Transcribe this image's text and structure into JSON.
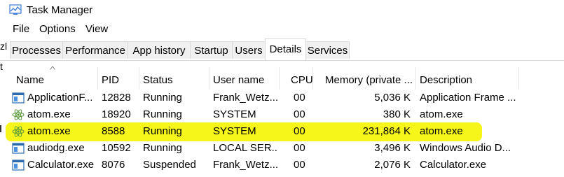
{
  "window": {
    "title": "Task Manager"
  },
  "menu": [
    "File",
    "Options",
    "View"
  ],
  "side_marks": [
    "zl",
    "t"
  ],
  "tabs": [
    {
      "label": "Processes",
      "active": false
    },
    {
      "label": "Performance",
      "active": false
    },
    {
      "label": "App history",
      "active": false
    },
    {
      "label": "Startup",
      "active": false
    },
    {
      "label": "Users",
      "active": false
    },
    {
      "label": "Details",
      "active": true
    },
    {
      "label": "Services",
      "active": false
    }
  ],
  "columns": {
    "name": "Name",
    "pid": "PID",
    "status": "Status",
    "user": "User name",
    "cpu": "CPU",
    "memory": "Memory (private ...",
    "description": "Description"
  },
  "rows": [
    {
      "icon": "app-frame-icon",
      "name": "ApplicationF...",
      "pid": "12828",
      "status": "Running",
      "user": "Frank_Wetz...",
      "cpu": "00",
      "memory": "5,036 K",
      "description": "Application Frame ..."
    },
    {
      "icon": "atom-icon",
      "name": "atom.exe",
      "pid": "18920",
      "status": "Running",
      "user": "SYSTEM",
      "cpu": "00",
      "memory": "380 K",
      "description": "atom.exe"
    },
    {
      "icon": "atom-icon",
      "name": "atom.exe",
      "pid": "8588",
      "status": "Running",
      "user": "SYSTEM",
      "cpu": "00",
      "memory": "231,864 K",
      "description": "atom.exe",
      "highlighted": true
    },
    {
      "icon": "app-frame-icon",
      "name": "audiodg.exe",
      "pid": "10592",
      "status": "Running",
      "user": "LOCAL SER...",
      "cpu": "00",
      "memory": "3,496 K",
      "description": "Windows Audio D..."
    },
    {
      "icon": "app-frame-icon",
      "name": "Calculator.exe",
      "pid": "8076",
      "status": "Suspended",
      "user": "Frank_Wetz...",
      "cpu": "00",
      "memory": "2,076 K",
      "description": "Calculator.exe"
    }
  ],
  "colors": {
    "highlight": "#f5f50f",
    "tab_border": "#d9d9d9"
  }
}
